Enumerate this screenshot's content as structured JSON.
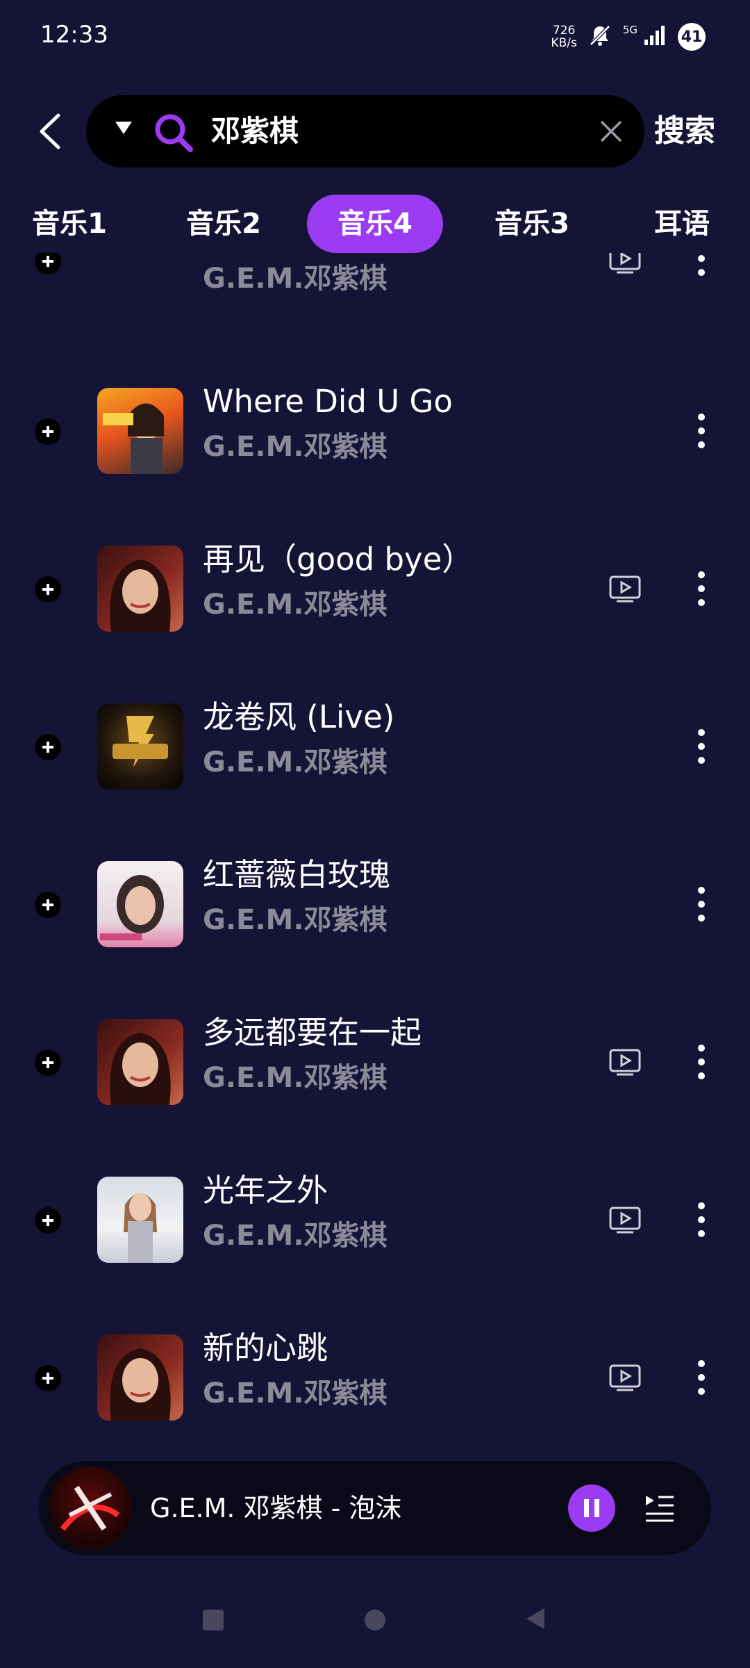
{
  "status": {
    "time": "12:33",
    "net_speed_value": "726",
    "net_speed_unit": "KB/s",
    "network": "5G",
    "battery": "41"
  },
  "search": {
    "query": "邓紫棋",
    "submit_label": "搜索"
  },
  "tabs": [
    "音乐1",
    "音乐2",
    "音乐4",
    "音乐3",
    "耳语"
  ],
  "active_tab": 2,
  "songs": [
    {
      "title": "",
      "artist": "G.E.M.邓紫棋",
      "has_mv": true
    },
    {
      "title": "Where Did U Go",
      "artist": "G.E.M.邓紫棋",
      "has_mv": false
    },
    {
      "title": "再见（good bye）",
      "artist": "G.E.M.邓紫棋",
      "has_mv": true
    },
    {
      "title": "龙卷风 (Live)",
      "artist": "G.E.M.邓紫棋",
      "has_mv": false
    },
    {
      "title": "红蔷薇白玫瑰",
      "artist": "G.E.M.邓紫棋",
      "has_mv": false
    },
    {
      "title": "多远都要在一起",
      "artist": "G.E.M.邓紫棋",
      "has_mv": true
    },
    {
      "title": "光年之外",
      "artist": "G.E.M.邓紫棋",
      "has_mv": true
    },
    {
      "title": "新的心跳",
      "artist": "G.E.M.邓紫棋",
      "has_mv": true
    }
  ],
  "player": {
    "now_playing": "G.E.M. 邓紫棋 - 泡沫"
  },
  "colors": {
    "background": "#161436",
    "accent": "#9b3cf2",
    "secondary_text": "#8b8a98"
  },
  "icons": [
    "back-arrow-icon",
    "dropdown-arrow-icon",
    "search-icon",
    "clear-icon",
    "add-icon",
    "mv-icon",
    "more-icon",
    "pause-icon",
    "queue-icon"
  ]
}
